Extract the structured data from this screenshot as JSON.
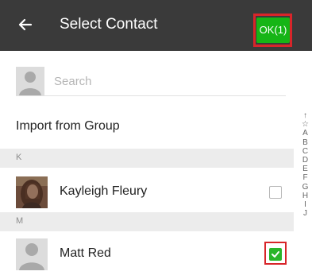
{
  "header": {
    "title": "Select Contact",
    "ok_label": "OK(1)"
  },
  "search": {
    "placeholder": "Search"
  },
  "import_label": "Import from Group",
  "sections": [
    {
      "letter": "K"
    },
    {
      "letter": "M"
    }
  ],
  "contacts": [
    {
      "name": "Kayleigh Fleury",
      "checked": false,
      "avatar": "photo"
    },
    {
      "name": "Matt Red",
      "checked": true,
      "avatar": "default-person-icon"
    }
  ],
  "index": [
    "↑",
    "☆",
    "A",
    "B",
    "C",
    "D",
    "E",
    "F",
    "G",
    "H",
    "I",
    "J"
  ],
  "colors": {
    "header_bg": "#3a3a3a",
    "ok_green": "#16b516",
    "highlight_red": "#d8252a",
    "check_green": "#2ab52a"
  }
}
